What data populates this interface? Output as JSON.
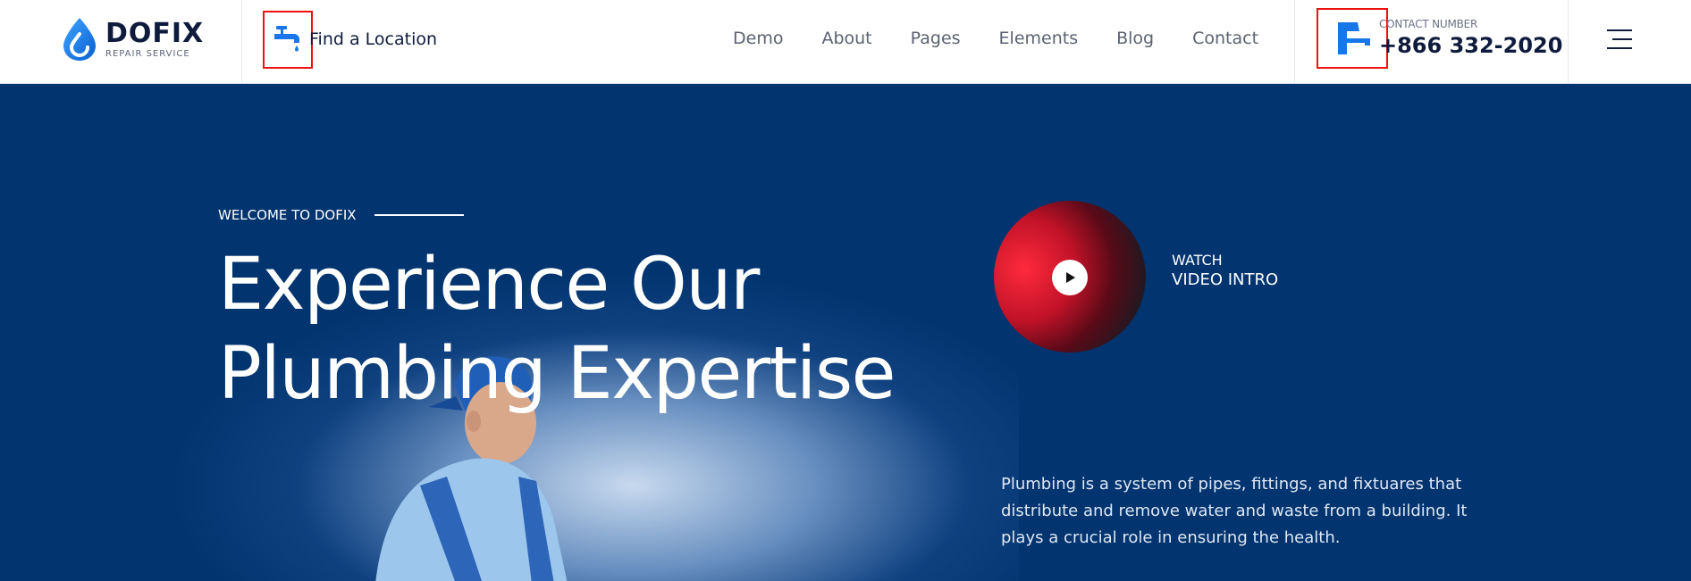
{
  "brand": {
    "name": "DOFIX",
    "tagline": "REPAIR SERVICE",
    "colors": {
      "primary": "#02346f",
      "accent": "#1877e8",
      "text": "#0f1b3d"
    }
  },
  "header": {
    "find_location": {
      "label": "Find a Location",
      "icon": "faucet-tap-icon"
    },
    "nav": [
      "Demo",
      "About",
      "Pages",
      "Elements",
      "Blog",
      "Contact"
    ],
    "contact": {
      "label": "CONTACT NUMBER",
      "number": "+866 332-2020",
      "icon": "faucet-icon"
    },
    "menu_icon": "hamburger-menu-icon"
  },
  "hero": {
    "eyebrow": "WELCOME TO DOFIX",
    "headline_line1": "Experience Our",
    "headline_line2": "Plumbing Expertise",
    "video": {
      "watch": "WATCH",
      "label": "VIDEO INTRO",
      "icon": "play-icon"
    },
    "description": "Plumbing is a system of pipes, fittings, and fixtuares that distribute and remove water and waste from a building. It plays a crucial role in ensuring the health."
  }
}
